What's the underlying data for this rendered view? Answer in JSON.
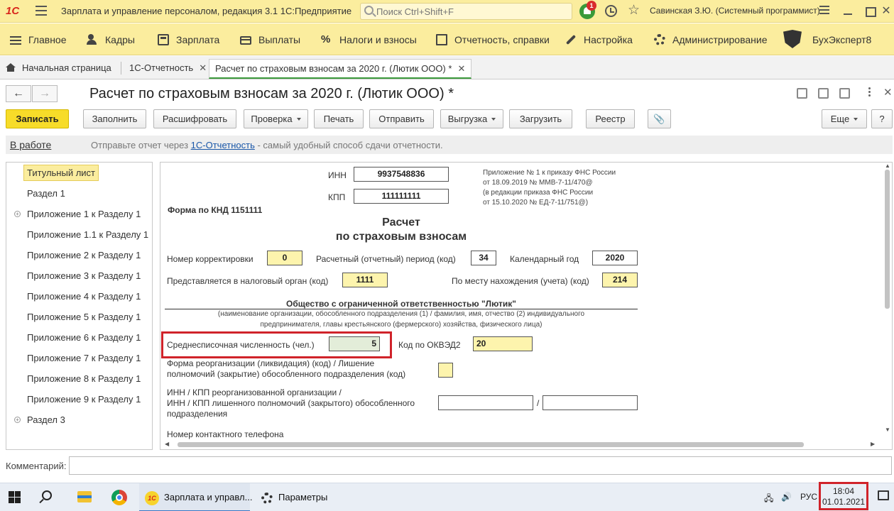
{
  "titlebar": {
    "logo": "1С",
    "app_title": "Зарплата и управление персоналом, редакция 3.1 1С:Предприятие",
    "search_placeholder": "Поиск Ctrl+Shift+F",
    "notifications_count": "1",
    "user": "Савинская З.Ю. (Системный программист)"
  },
  "sections": [
    {
      "label": "Главное",
      "icon": "menu-icon"
    },
    {
      "label": "Кадры",
      "icon": "people-icon"
    },
    {
      "label": "Зарплата",
      "icon": "calculator-icon"
    },
    {
      "label": "Выплаты",
      "icon": "wallet-icon"
    },
    {
      "label": "Налоги и взносы",
      "icon": "percent-icon"
    },
    {
      "label": "Отчетность, справки",
      "icon": "reports-icon"
    },
    {
      "label": "Настройка",
      "icon": "wrench-icon"
    },
    {
      "label": "Администрирование",
      "icon": "gear-icon"
    },
    {
      "label": "БухЭксперт8",
      "icon": "buhexpert-logo-icon"
    }
  ],
  "tabs": [
    {
      "label": "Начальная страница"
    },
    {
      "label": "1С-Отчетность"
    },
    {
      "label": "Расчет по страховым взносам за 2020 г. (Лютик ООО) *",
      "active": true
    }
  ],
  "document": {
    "title": "Расчет по страховым взносам за 2020 г. (Лютик ООО) *"
  },
  "toolbar": {
    "save": "Записать",
    "fill": "Заполнить",
    "decode": "Расшифровать",
    "check": "Проверка",
    "print": "Печать",
    "send": "Отправить",
    "export": "Выгрузка",
    "load": "Загрузить",
    "registry": "Реестр",
    "more": "Еще",
    "help": "?"
  },
  "status": {
    "state": "В работе",
    "hint_before": "Отправьте отчет через ",
    "hint_link": "1С-Отчетность",
    "hint_after": " - самый удобный способ сдачи отчетности."
  },
  "nav": [
    {
      "label": "Титульный лист",
      "selected": true,
      "expandable": false
    },
    {
      "label": "Раздел 1",
      "expandable": false
    },
    {
      "label": "Приложение 1 к Разделу 1",
      "expandable": true
    },
    {
      "label": "Приложение 1.1 к Разделу 1",
      "expandable": false
    },
    {
      "label": "Приложение 2 к Разделу 1",
      "expandable": false
    },
    {
      "label": "Приложение 3 к Разделу 1",
      "expandable": false
    },
    {
      "label": "Приложение 4 к Разделу 1",
      "expandable": false
    },
    {
      "label": "Приложение 5 к Разделу 1",
      "expandable": false
    },
    {
      "label": "Приложение 6 к Разделу 1",
      "expandable": false
    },
    {
      "label": "Приложение 7 к Разделу 1",
      "expandable": false
    },
    {
      "label": "Приложение 8 к Разделу 1",
      "expandable": false
    },
    {
      "label": "Приложение 9 к Разделу 1",
      "expandable": false
    },
    {
      "label": "Раздел 3",
      "expandable": true
    }
  ],
  "form": {
    "inn_label": "ИНН",
    "inn": "9937548836",
    "kpp_label": "КПП",
    "kpp": "111111111",
    "annex_line1": "Приложение № 1 к приказу ФНС России",
    "annex_line2": "от 18.09.2019 № ММВ-7-11/470@",
    "annex_line3": "(в редакции приказа ФНС России",
    "annex_line4": "от 15.10.2020 № ЕД-7-11/751@)",
    "knd": "Форма по КНД 1151111",
    "heading1": "Расчет",
    "heading2": "по страховым взносам",
    "correction_label": "Номер корректировки",
    "correction": "0",
    "period_label": "Расчетный (отчетный) период (код)",
    "period": "34",
    "year_label": "Календарный год",
    "year": "2020",
    "tax_office_label": "Представляется в налоговый орган (код)",
    "tax_office": "1111",
    "location_label": "По месту нахождения (учета) (код)",
    "location": "214",
    "org_name": "Общество с ограниченной ответственностью \"Лютик\"",
    "org_hint1": "(наименование организации, обособленного подразделения (1) / фамилия, имя, отчество (2) индивидуального",
    "org_hint2": "предпринимателя, главы крестьянского (фермерского) хозяйства, физического лица)",
    "headcount_label": "Среднесписочная численность (чел.)",
    "headcount": "5",
    "okved_label": "Код по ОКВЭД2",
    "okved": "20",
    "reorg_label1": "Форма реорганизации (ликвидация) (код) / Лишение",
    "reorg_label2": "полномочий (закрытие) обособленного подразделения (код)",
    "reorg_inn_label1": "ИНН / КПП реорганизованной организации /",
    "reorg_inn_label2": "ИНН / КПП лишенного полномочий (закрытого) обособленного",
    "reorg_inn_label3": "подразделения",
    "slash": "/",
    "phone_label": "Номер контактного телефона"
  },
  "comment": {
    "label": "Комментарий:",
    "value": ""
  },
  "taskbar": {
    "app1": "Зарплата и управл...",
    "app2": "Параметры",
    "lang": "РУС",
    "time": "18:04",
    "date": "01.01.2021"
  }
}
